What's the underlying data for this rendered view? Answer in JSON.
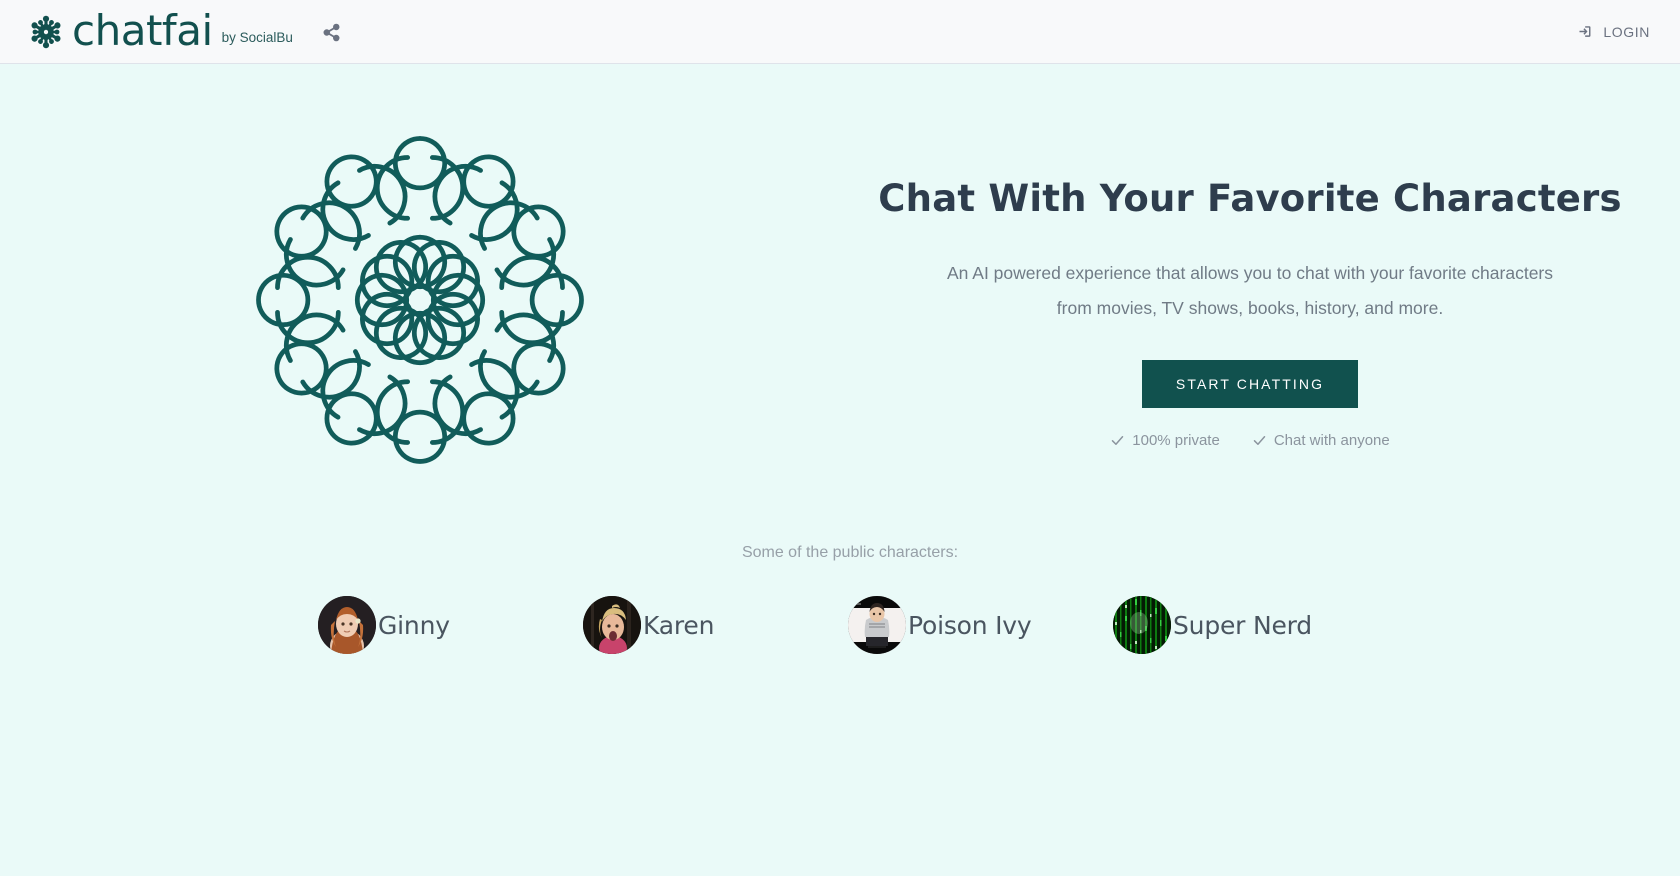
{
  "header": {
    "brand_wordmark": "chatfai",
    "brand_byline": "by SocialBu",
    "share_icon": "share-icon",
    "login_label": "LOGIN",
    "login_icon": "sign-in-icon",
    "background_color": "#f8f9fa"
  },
  "hero": {
    "illustration_name": "chatfai-molecule-illustration",
    "title": "Chat With Your Favorite Characters",
    "subtitle": "An AI powered experience that allows you to chat with your favorite characters from movies, TV shows, books, history, and more.",
    "cta_label": "START CHATTING",
    "cta_color": "#11514e",
    "features": [
      {
        "icon": "check-icon",
        "label": "100% private"
      },
      {
        "icon": "check-icon",
        "label": "Chat with anyone"
      }
    ]
  },
  "characters": {
    "caption": "Some of the public characters:",
    "items": [
      {
        "name": "Ginny",
        "avatar": "ginny-avatar"
      },
      {
        "name": "Karen",
        "avatar": "karen-avatar"
      },
      {
        "name": "Poison Ivy",
        "avatar": "poison-ivy-avatar"
      },
      {
        "name": "Super Nerd",
        "avatar": "super-nerd-avatar"
      }
    ]
  },
  "theme": {
    "page_background": "#eafaf8",
    "brand_teal": "#12504e",
    "heading_color": "#2e3d4d",
    "muted_text": "#707b86"
  }
}
